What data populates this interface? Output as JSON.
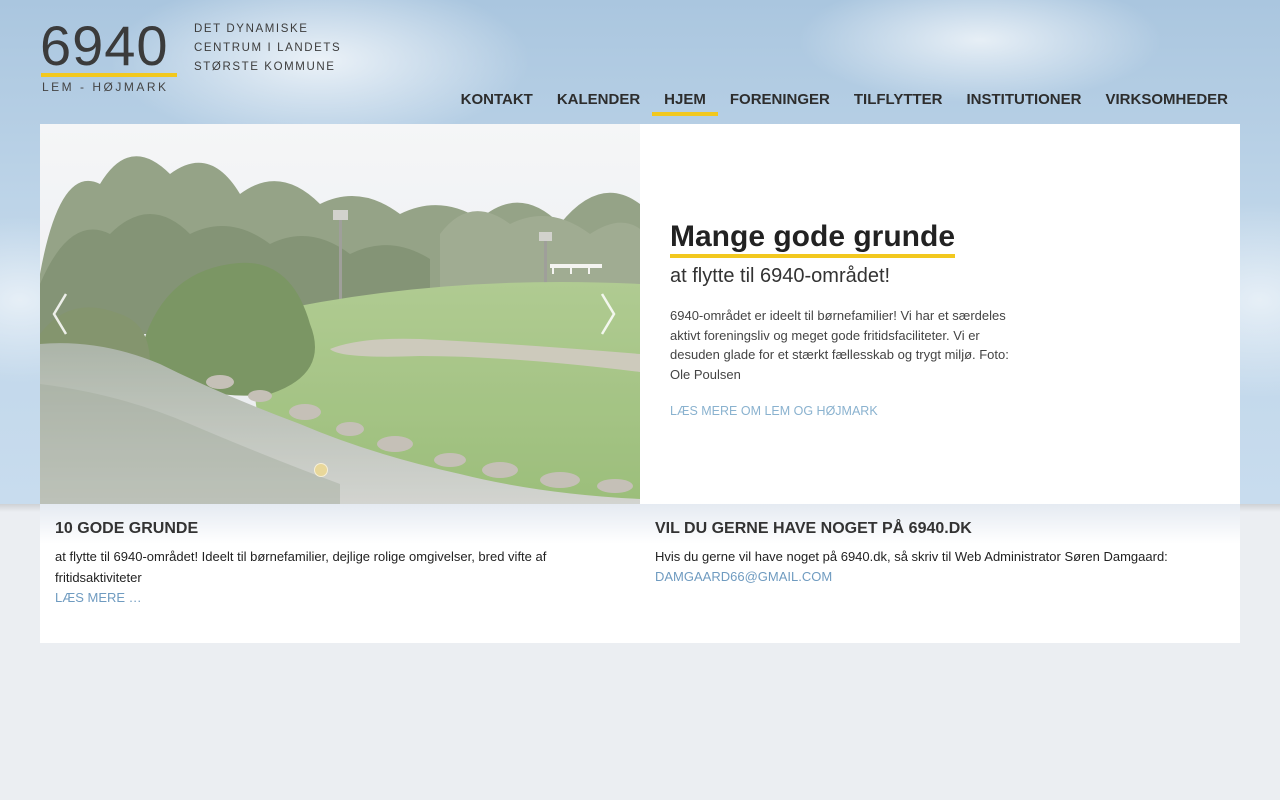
{
  "logo": {
    "number": "6940",
    "subtitle": "LEM - HØJMARK",
    "tagline": [
      "DET DYNAMISKE",
      "CENTRUM I LANDETS",
      "STØRSTE KOMMUNE"
    ]
  },
  "nav": {
    "items": [
      "KONTAKT",
      "KALENDER",
      "HJEM",
      "FORENINGER",
      "TILFLYTTER",
      "INSTITUTIONER",
      "VIRKSOMHEDER"
    ],
    "active": "HJEM"
  },
  "hero": {
    "title": "Mange gode grunde",
    "subtitle": "at flytte til 6940-området!",
    "body": "6940-området er ideelt til børnefamilier! Vi har et særdeles aktivt foreningsliv og meget gode fritidsfaciliteter. Vi er desuden glade for et stærkt fællesskab og trygt miljø. Foto: Ole Poulsen",
    "link": "LÆS MERE OM LEM OG HØJMARK"
  },
  "info": {
    "left": {
      "title": "10 GODE GRUNDE",
      "text": "at flytte til 6940-området! Ideelt til børnefamilier, dejlige rolige omgivelser, bred vifte af fritidsaktiviteter",
      "link": "LÆS MERE …"
    },
    "right": {
      "title": "VIL DU GERNE HAVE NOGET PÅ 6940.DK",
      "text": "Hvis du gerne vil have noget på 6940.dk, så skriv til Web Administrator Søren Damgaard:",
      "link": "DAMGAARD66@GMAIL.COM"
    }
  },
  "colors": {
    "accent": "#f2c81e",
    "link": "#6f9bc0",
    "page_bg": "#ebeef2"
  }
}
